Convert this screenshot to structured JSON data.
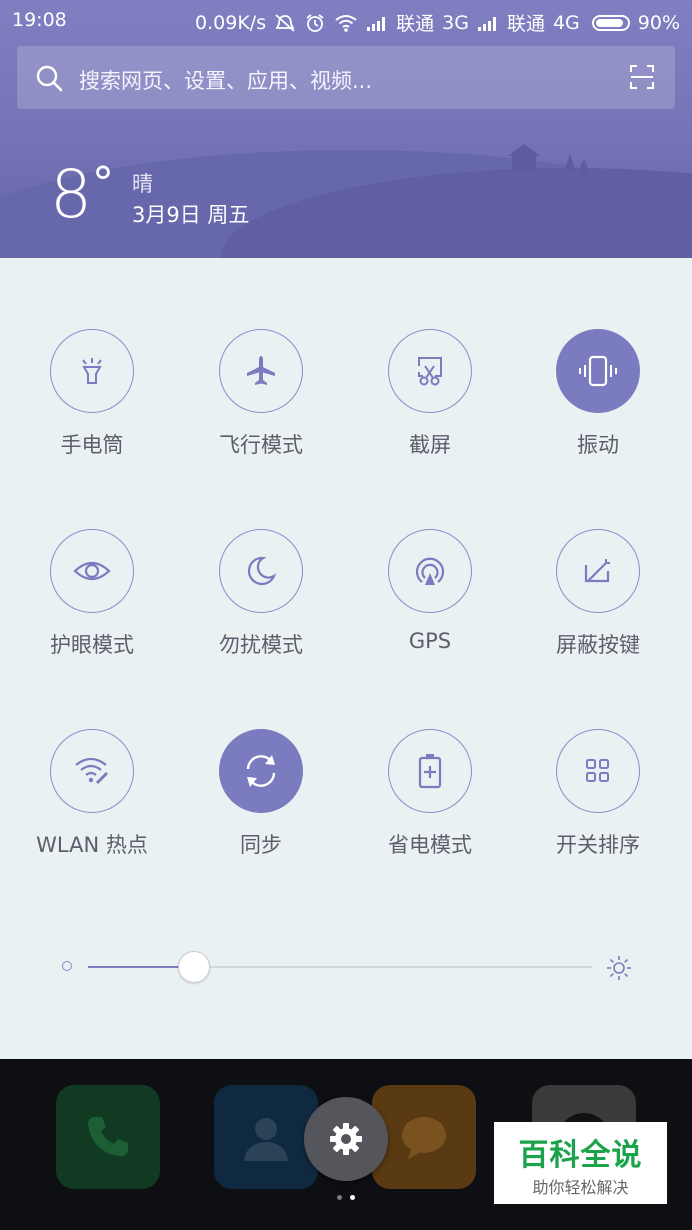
{
  "status_bar": {
    "time": "19:08",
    "speed": "0.09K/s",
    "carrier1": "联通",
    "net1": "3G",
    "carrier2": "联通",
    "net2": "4G",
    "battery": "90%"
  },
  "search": {
    "placeholder": "搜索网页、设置、应用、视频..."
  },
  "weather": {
    "temp": "8",
    "degree_symbol": "°",
    "condition": "晴",
    "date": "3月9日 周五"
  },
  "quick_tiles": [
    {
      "label": "手电筒",
      "icon": "flashlight-icon",
      "on": false
    },
    {
      "label": "飞行模式",
      "icon": "airplane-icon",
      "on": false
    },
    {
      "label": "截屏",
      "icon": "screenshot-icon",
      "on": false
    },
    {
      "label": "振动",
      "icon": "vibrate-icon",
      "on": true
    },
    {
      "label": "护眼模式",
      "icon": "eye-icon",
      "on": false
    },
    {
      "label": "勿扰模式",
      "icon": "moon-icon",
      "on": false
    },
    {
      "label": "GPS",
      "icon": "gps-icon",
      "on": false
    },
    {
      "label": "屏蔽按键",
      "icon": "block-keys-icon",
      "on": false
    },
    {
      "label": "WLAN 热点",
      "icon": "hotspot-icon",
      "on": false
    },
    {
      "label": "同步",
      "icon": "sync-icon",
      "on": true
    },
    {
      "label": "省电模式",
      "icon": "battery-saver-icon",
      "on": false
    },
    {
      "label": "开关排序",
      "icon": "grid-icon",
      "on": false
    }
  ],
  "brightness": {
    "level": 0.21
  },
  "dock": {
    "apps": [
      "phone-icon",
      "contacts-icon",
      "messages-icon",
      "app-icon"
    ],
    "page_count": 2,
    "active_page": 1
  },
  "watermark": {
    "title": "百科全说",
    "subtitle": "助你轻松解决"
  },
  "colors": {
    "accent": "#7b7bbf",
    "panel": "#eaf1f2",
    "header": "#7373b5"
  }
}
